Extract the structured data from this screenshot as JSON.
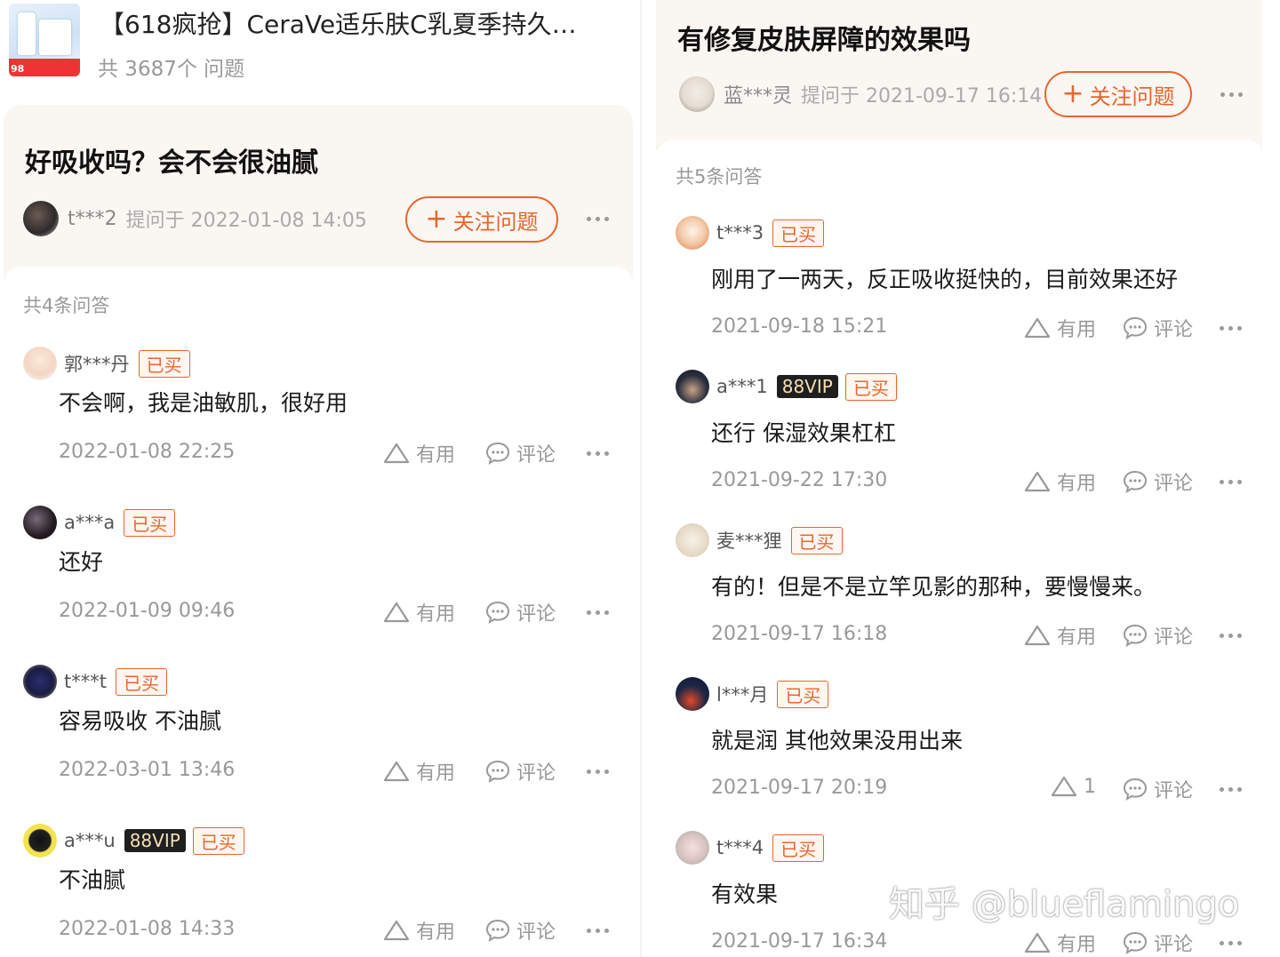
{
  "left": {
    "product": {
      "title": "【618疯抢】CeraVe适乐肤C乳夏季持久…",
      "count_text": "共 3687个 问题",
      "thumb_tag": "98"
    },
    "question": {
      "title": "好吸收吗？会不会很油腻",
      "asker_name": "t***2",
      "asked_time": "提问于 2022-01-08 14:05",
      "follow_label": "关注问题"
    },
    "answers_count": "共4条问答",
    "answers": [
      {
        "user": "郭***丹",
        "vip": "",
        "bought": "已买",
        "text": "不会啊，我是油敏肌，很好用",
        "time": "2022-01-08 22:25",
        "useful": "有用",
        "comment": "评论"
      },
      {
        "user": "a***a",
        "vip": "",
        "bought": "已买",
        "text": "还好",
        "time": "2022-01-09 09:46",
        "useful": "有用",
        "comment": "评论"
      },
      {
        "user": "t***t",
        "vip": "",
        "bought": "已买",
        "text": "容易吸收 不油腻",
        "time": "2022-03-01 13:46",
        "useful": "有用",
        "comment": "评论"
      },
      {
        "user": "a***u",
        "vip": "88VIP",
        "bought": "已买",
        "text": "不油腻",
        "time": "2022-01-08 14:33",
        "useful": "有用",
        "comment": "评论"
      }
    ]
  },
  "right": {
    "question": {
      "title": "有修复皮肤屏障的效果吗",
      "asker_name": "蓝***灵",
      "asked_time": "提问于 2021-09-17 16:14",
      "follow_label": "关注问题"
    },
    "answers_count": "共5条问答",
    "answers": [
      {
        "user": "t***3",
        "vip": "",
        "bought": "已买",
        "text": "刚用了一两天，反正吸收挺快的，目前效果还好",
        "time": "2021-09-18 15:21",
        "useful": "有用",
        "comment": "评论"
      },
      {
        "user": "a***1",
        "vip": "88VIP",
        "bought": "已买",
        "text": "还行 保湿效果杠杠",
        "time": "2021-09-22 17:30",
        "useful": "有用",
        "comment": "评论"
      },
      {
        "user": "麦***狸",
        "vip": "",
        "bought": "已买",
        "text": "有的！但是不是立竿见影的那种，要慢慢来。",
        "time": "2021-09-17 16:18",
        "useful": "有用",
        "comment": "评论"
      },
      {
        "user": "l***月",
        "vip": "",
        "bought": "已买",
        "text": "就是润 其他效果没用出来",
        "time": "2021-09-17 20:19",
        "useful": "1",
        "comment": "评论"
      },
      {
        "user": "t***4",
        "vip": "",
        "bought": "已买",
        "text": "有效果",
        "time": "2021-09-17 16:34",
        "useful": "有用",
        "comment": "评论"
      }
    ]
  },
  "watermark": "知乎 @blueflamingo",
  "colors": {
    "accent": "#e8652d",
    "vip_bg": "#1f1f1f",
    "vip_fg": "#f5dfb4",
    "header_bg": "#faf6f2"
  },
  "icons": [
    "useful-triangle-icon",
    "comment-bubble-icon",
    "more-dots-icon",
    "plus-icon"
  ]
}
